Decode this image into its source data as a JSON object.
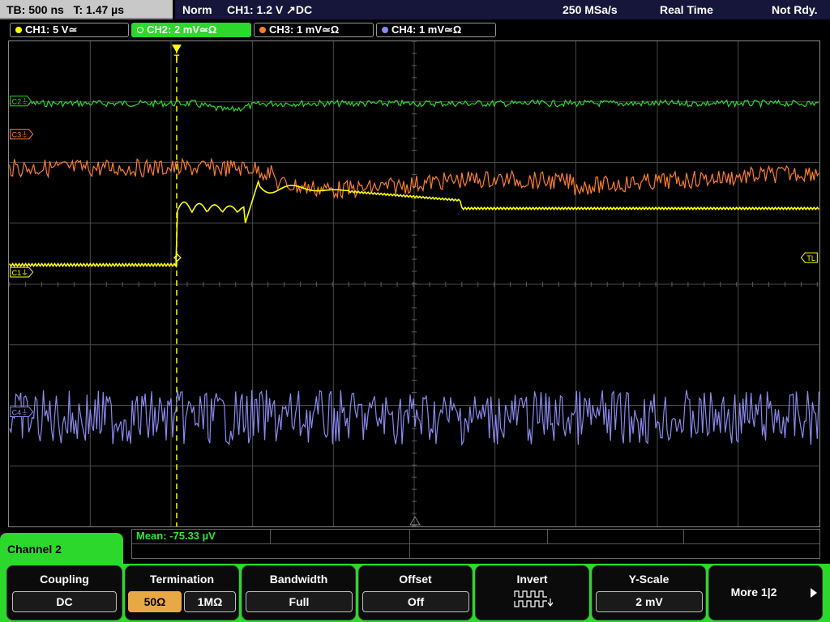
{
  "top": {
    "timebase": "TB: 500 ns",
    "trigger_pos": "T: 1.47 µs",
    "mode": "Norm",
    "trigger_info": "CH1: 1.2 V ↗DC",
    "sample_rate": "250 MSa/s",
    "acq_mode": "Real Time",
    "status": "Not Rdy."
  },
  "channels": [
    {
      "label": "CH1: 5 V≃",
      "color": "#ffff00"
    },
    {
      "label": "CH2: 2 mV≃Ω",
      "color": "#2bd82b"
    },
    {
      "label": "CH3: 1 mV≃Ω",
      "color": "#ff7f2a"
    },
    {
      "label": "CH4: 1 mV≃Ω",
      "color": "#8a8aee"
    }
  ],
  "markers": {
    "c1": "C1⏚",
    "c2": "C2⏚",
    "c3": "C3⏚",
    "c4": "C4⏚",
    "trig_level": "TL",
    "trigger_top": "T"
  },
  "measurement": {
    "mean": "Mean: -75.33 µV"
  },
  "menu": {
    "channel_title": "Channel 2",
    "coupling_title": "Coupling",
    "coupling_value": "DC",
    "termination_title": "Termination",
    "termination_opt1": "50Ω",
    "termination_opt2": "1MΩ",
    "bandwidth_title": "Bandwidth",
    "bandwidth_value": "Full",
    "offset_title": "Offset",
    "offset_value": "Off",
    "invert_title": "Invert",
    "yscale_title": "Y-Scale",
    "yscale_value": "2 mV",
    "more_label": "More 1|2"
  }
}
